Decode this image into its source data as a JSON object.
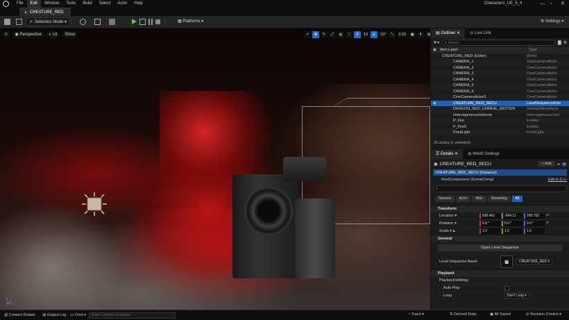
{
  "window": {
    "title": "Characters_UE_5_4"
  },
  "menu": [
    "File",
    "Edit",
    "Window",
    "Tools",
    "Build",
    "Select",
    "Actor",
    "Help"
  ],
  "menu_active": "Edit",
  "level_tab": "CREATURE_RED",
  "toolbar": {
    "selection_mode": "Selection Mode",
    "platforms": "Platforms",
    "settings": "Settings"
  },
  "viewport": {
    "perspective": "Perspective",
    "lit": "Lit",
    "show": "Show",
    "grid_snap": "10",
    "rot_snap": "10°",
    "scale_snap": "0.25",
    "cam_speed": "4"
  },
  "outliner": {
    "tab": "Outliner",
    "tab2": "Live Link",
    "search_placeholder": "Search...",
    "col_label": "Item Label",
    "col_type": "Type",
    "rows": [
      {
        "name": "CREATURE_RED (Editor)",
        "type": "World"
      },
      {
        "name": "CAMERA_1",
        "type": "CineCameraActor"
      },
      {
        "name": "CAMERA_2",
        "type": "CineCameraActor"
      },
      {
        "name": "CAMERA_3",
        "type": "CineCameraActor"
      },
      {
        "name": "CAMERA_4",
        "type": "CineCameraActor"
      },
      {
        "name": "CAMERA_5",
        "type": "CineCameraActor"
      },
      {
        "name": "CAMERA_6",
        "type": "CineCameraActor"
      },
      {
        "name": "CineCameraActor3",
        "type": "CineCameraActor"
      },
      {
        "name": "CREATURE_RED_SECU",
        "type": "LevelSequenceActo"
      },
      {
        "name": "DRAGON_RED_UNREAL_MOTION",
        "type": "SkeletalMeshActor"
      },
      {
        "name": "HeterogeneousVolume",
        "type": "HeterogeneousVolu"
      },
      {
        "name": "P_Fire",
        "type": "Emitter"
      },
      {
        "name": "P_Fire5",
        "type": "Emitter"
      },
      {
        "name": "PointLight",
        "type": "PointLight"
      }
    ],
    "footer": "25 actors (1 selected)"
  },
  "details": {
    "tab": "Details",
    "tab2": "World Settings",
    "actor_name": "CREATURE_RED_SECU",
    "add_label": "+ Add",
    "instance": "CREATURE_RED_SECU (Instance)",
    "root": "RootComponent (SceneComp)",
    "edit_cpp": "Edit in C++",
    "filters": [
      "General",
      "Actor",
      "Misc",
      "Streaming",
      "All"
    ],
    "transform_cat": "Transform",
    "location_label": "Location",
    "location": [
      "930.462",
      "-964.11",
      "295.702"
    ],
    "rotation_label": "Rotation",
    "rotation": [
      "0.0 °",
      "0.0 °",
      "0.0 °"
    ],
    "scale_label": "Scale",
    "scale": [
      "1.0",
      "1.0",
      "1.0"
    ],
    "general_cat": "General",
    "open_seq": "Open Level Sequence",
    "level_seq_label": "Level Sequence Asset",
    "level_seq_value": "CREATURE_RED",
    "playback_cat": "Playback",
    "playback_settings": "PlaybackSettings",
    "auto_play": "Auto Play",
    "loop_label": "Loop",
    "loop_value": "Don't Loop"
  },
  "status": {
    "content_drawer": "Content Drawer",
    "output_log": "Output Log",
    "cmd": "Cmd",
    "console_placeholder": "Enter Console Command",
    "trace": "Trace",
    "derived_data": "Derived Data",
    "all_saved": "All Saved",
    "revision": "Revision Control"
  },
  "colors": {
    "accent": "#1b62b8",
    "play": "#5ec435"
  }
}
